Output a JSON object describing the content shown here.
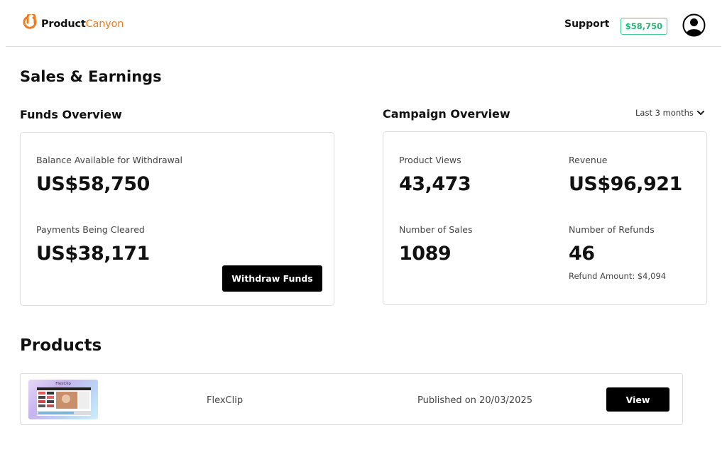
{
  "header": {
    "brand_primary": "Product",
    "brand_accent": "Canyon",
    "support_label": "Support",
    "balance_badge": "$58,750",
    "avatar_icon": "user-circle-icon"
  },
  "page": {
    "title": "Sales & Earnings"
  },
  "funds": {
    "title": "Funds Overview",
    "balance_label": "Balance Available for Withdrawal",
    "balance_value": "US$58,750",
    "clearing_label": "Payments Being Cleared",
    "clearing_value": "US$38,171",
    "withdraw_label": "Withdraw Funds"
  },
  "campaign": {
    "title": "Campaign Overview",
    "period_label": "Last 3 months",
    "views_label": "Product Views",
    "views_value": "43,473",
    "revenue_label": "Revenue",
    "revenue_value": "US$96,921",
    "sales_label": "Number of Sales",
    "sales_value": "1089",
    "refunds_label": "Number of Refunds",
    "refunds_value": "46",
    "refund_amount": "Refund Amount: $4,094"
  },
  "products": {
    "title": "Products",
    "items": [
      {
        "thumb_title": "FlexClip",
        "name": "FlexClip",
        "published": "Published on 20/03/2025",
        "view_label": "View"
      }
    ]
  },
  "colors": {
    "accent_orange": "#f07b1f",
    "badge_green": "#22b573",
    "button_black": "#000000"
  }
}
